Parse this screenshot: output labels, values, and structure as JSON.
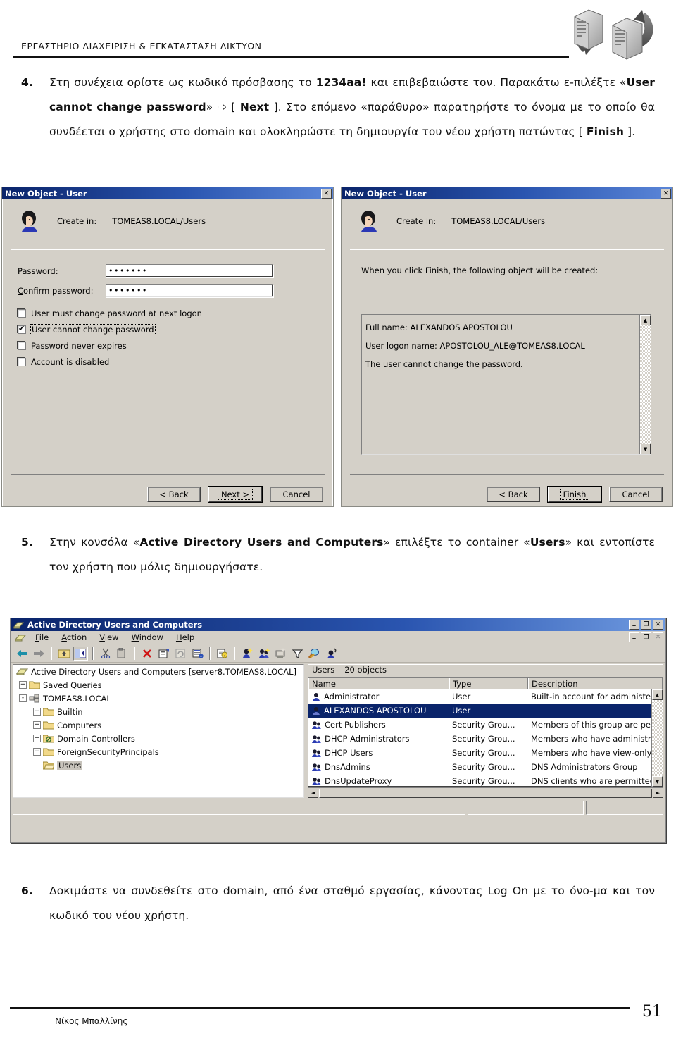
{
  "header": {
    "lab_title": "ΕΡΓΑΣΤΗΡΙΟ ΔΙΑΧΕΙΡΙΣΗ & ΕΓΚΑΤΑΣΤΑΣΗ ΔΙΚΤΥΩΝ",
    "graphic_name": "two-servers-sync-icon"
  },
  "steps": {
    "step4": {
      "number": "4.",
      "text_part1": "Στη συνέχεια ορίστε ως κωδικό πρόσβασης το ",
      "password_bold": "1234aa!",
      "text_part2": " και επιβεβαιώστε τον. Παρακάτω ε-πιλέξτε «",
      "option_bold": "User cannot change password",
      "text_part3": "» ",
      "arrow": "⇨",
      "text_part4": " [ ",
      "next_bold": "Next",
      "text_part5": " ]. Στο επόμενο «παράθυρο» παρατηρήστε το όνομα με το οποίο θα συνδέεται ο χρήστης στο domain και ολοκληρώστε τη δημιουργία του νέου χρήστη πατώντας [ ",
      "finish_bold": "Finish",
      "text_part6": " ]."
    },
    "step5": {
      "number": "5.",
      "text_part1": "Στην κονσόλα «",
      "console_bold": "Active Directory Users and Computers",
      "text_part2": "» επιλέξτε το container «",
      "users_bold": "Users",
      "text_part3": "» και εντοπίστε τον χρήστη που μόλις δημιουργήσατε."
    },
    "step6": {
      "number": "6.",
      "text": "Δοκιμάστε να συνδεθείτε στο domain, από ένα σταθμό εργασίας, κάνοντας Log On με το όνο-μα και τον κωδικό του νέου χρήστη."
    }
  },
  "dialog_left": {
    "title": "New Object - User",
    "close_label": "✕",
    "create_in_label": "Create in:",
    "create_in_value": "TOMEAS8.LOCAL/Users",
    "password_label": "Password:",
    "password_value": "•••••••",
    "confirm_label": "Confirm password:",
    "confirm_value": "•••••••",
    "checkboxes": [
      {
        "label": "User must change password at next logon",
        "checked": false,
        "focused": false
      },
      {
        "label": "User cannot change password",
        "checked": true,
        "focused": true
      },
      {
        "label": "Password never expires",
        "checked": false,
        "focused": false
      },
      {
        "label": "Account is disabled",
        "checked": false,
        "focused": false
      }
    ],
    "buttons": [
      {
        "label": "< Back",
        "default": false
      },
      {
        "label": "Next >",
        "default": true
      },
      {
        "label": "Cancel",
        "default": false
      }
    ]
  },
  "dialog_right": {
    "title": "New Object - User",
    "close_label": "✕",
    "create_in_label": "Create in:",
    "create_in_value": "TOMEAS8.LOCAL/Users",
    "summary_intro": "When you click Finish, the following object will be created:",
    "summary_lines": [
      "Full name: ALEXANDOS APOSTOLOU",
      "User logon name: APOSTOLOU_ALE@TOMEAS8.LOCAL",
      "The user cannot change the password."
    ],
    "scroll_up": "▲",
    "scroll_down": "▼",
    "buttons": [
      {
        "label": "< Back",
        "default": false
      },
      {
        "label": "Finish",
        "default": true
      },
      {
        "label": "Cancel",
        "default": false
      }
    ]
  },
  "ad_console": {
    "title": "Active Directory Users and Computers",
    "window_buttons": [
      {
        "name": "minimize-button",
        "glyph": "_"
      },
      {
        "name": "maximize-button",
        "glyph": "❐"
      },
      {
        "name": "close-button",
        "glyph": "✕"
      }
    ],
    "child_window_buttons": [
      {
        "name": "child-minimize-button",
        "glyph": "_"
      },
      {
        "name": "child-restore-button",
        "glyph": "❐"
      },
      {
        "name": "child-close-button",
        "glyph": "✕"
      }
    ],
    "menus": [
      "File",
      "Action",
      "View",
      "Window",
      "Help"
    ],
    "toolbar_icons": [
      "back-arrow-icon",
      "forward-arrow-icon",
      "sep",
      "up-one-level-icon",
      "show-hide-tree-icon",
      "sep",
      "cut-icon",
      "copy-icon",
      "sep",
      "delete-icon",
      "properties-icon",
      "refresh-icon",
      "export-list-icon",
      "sep",
      "help-icon",
      "sep",
      "new-user-icon",
      "new-group-icon",
      "new-computer-icon",
      "filter-icon",
      "find-icon",
      "saved-query-icon"
    ],
    "tree": {
      "root": "Active Directory Users and Computers [server8.TOMEAS8.LOCAL]",
      "nodes": [
        {
          "label": "Saved Queries",
          "expander": "+",
          "level": 1,
          "icon": "folder-icon",
          "selected": false
        },
        {
          "label": "TOMEAS8.LOCAL",
          "expander": "-",
          "level": 1,
          "icon": "domain-icon",
          "selected": false
        },
        {
          "label": "Builtin",
          "expander": "+",
          "level": 2,
          "icon": "folder-icon",
          "selected": false
        },
        {
          "label": "Computers",
          "expander": "+",
          "level": 2,
          "icon": "folder-icon",
          "selected": false
        },
        {
          "label": "Domain Controllers",
          "expander": "+",
          "level": 2,
          "icon": "ou-folder-icon",
          "selected": false
        },
        {
          "label": "ForeignSecurityPrincipals",
          "expander": "+",
          "level": 2,
          "icon": "folder-icon",
          "selected": false
        },
        {
          "label": "Users",
          "expander": "",
          "level": 2,
          "icon": "folder-icon",
          "selected": true
        }
      ]
    },
    "list_header": {
      "container": "Users",
      "count": "20 objects"
    },
    "columns": [
      "Name",
      "Type",
      "Description"
    ],
    "rows": [
      {
        "name": "Administrator",
        "type": "User",
        "description": "Built-in account for administerin",
        "icon": "user-icon",
        "selected": false
      },
      {
        "name": "ALEXANDOS APOSTOLOU",
        "type": "User",
        "description": "",
        "icon": "user-icon",
        "selected": true
      },
      {
        "name": "Cert Publishers",
        "type": "Security Grou...",
        "description": "Members of this group are perm",
        "icon": "group-icon",
        "selected": false
      },
      {
        "name": "DHCP Administrators",
        "type": "Security Grou...",
        "description": "Members who have administrati",
        "icon": "group-icon",
        "selected": false
      },
      {
        "name": "DHCP Users",
        "type": "Security Grou...",
        "description": "Members who have view-only a",
        "icon": "group-icon",
        "selected": false
      },
      {
        "name": "DnsAdmins",
        "type": "Security Grou...",
        "description": "DNS Administrators Group",
        "icon": "group-icon",
        "selected": false
      },
      {
        "name": "DnsUpdateProxy",
        "type": "Security Grou...",
        "description": "DNS clients who are permitted t",
        "icon": "group-icon",
        "selected": false
      }
    ],
    "scroll_up": "▲",
    "scroll_down": "▼",
    "scroll_left": "◄",
    "scroll_right": "►"
  },
  "footer": {
    "author": "Νίκος Μπαλλίνης",
    "page_number": "51"
  },
  "colors": {
    "title_bar_start": "#0a246a",
    "title_bar_end": "#5b86d8",
    "dialog_face": "#d4d0c8",
    "selection": "#0a246a",
    "text": "#111111"
  }
}
